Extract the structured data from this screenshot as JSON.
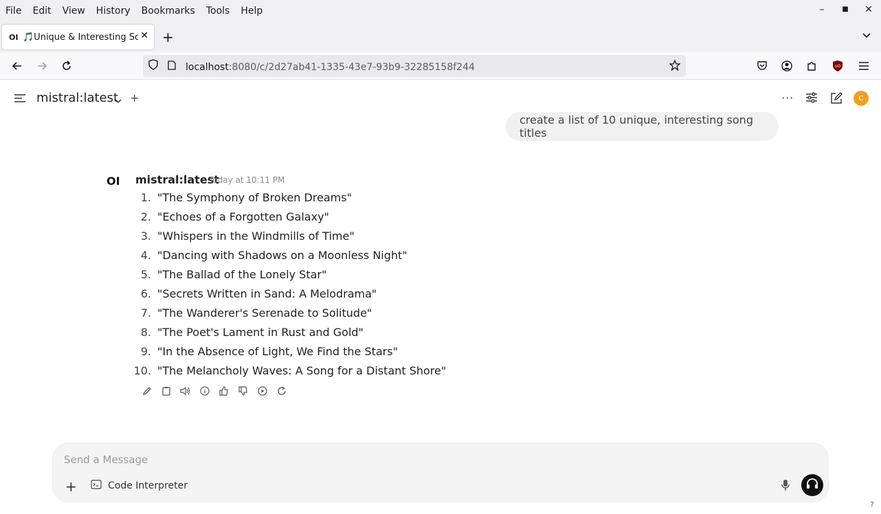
{
  "menubar": {
    "items": [
      "File",
      "Edit",
      "View",
      "History",
      "Bookmarks",
      "Tools",
      "Help"
    ]
  },
  "tab": {
    "favicon": "OI",
    "title": "🎵Unique & Interesting Song Titles"
  },
  "urlbar": {
    "host": "localhost",
    "path": ":8080/c/2d27ab41-1335-43e7-93b9-32285158f244"
  },
  "header": {
    "model_title": "mistral:latest",
    "avatar_letter": "C",
    "avatar_color": "#f0a020"
  },
  "user_message": {
    "text": "create a list of 10 unique, interesting song titles"
  },
  "assistant": {
    "logo": "OI",
    "name": "mistral:latest",
    "timestamp": "Today at 10:11 PM",
    "songs": [
      {
        "num": "1.",
        "title": "\"The Symphony of Broken Dreams\""
      },
      {
        "num": "2.",
        "title": "\"Echoes of a Forgotten Galaxy\""
      },
      {
        "num": "3.",
        "title": "\"Whispers in the Windmills of Time\""
      },
      {
        "num": "4.",
        "title": "\"Dancing with Shadows on a Moonless Night\""
      },
      {
        "num": "5.",
        "title": "\"The Ballad of the Lonely Star\""
      },
      {
        "num": "6.",
        "title": "\"Secrets Written in Sand: A Melodrama\""
      },
      {
        "num": "7.",
        "title": "\"The Wanderer's Serenade to Solitude\""
      },
      {
        "num": "8.",
        "title": "\"The Poet's Lament in Rust and Gold\""
      },
      {
        "num": "9.",
        "title": "\"In the Absence of Light, We Find the Stars\""
      },
      {
        "num": "10.",
        "title": "\"The Melancholy Waves: A Song for a Distant Shore\""
      }
    ]
  },
  "composer": {
    "placeholder": "Send a Message",
    "code_interpreter_label": "Code Interpreter"
  },
  "help": {
    "label": "?"
  }
}
